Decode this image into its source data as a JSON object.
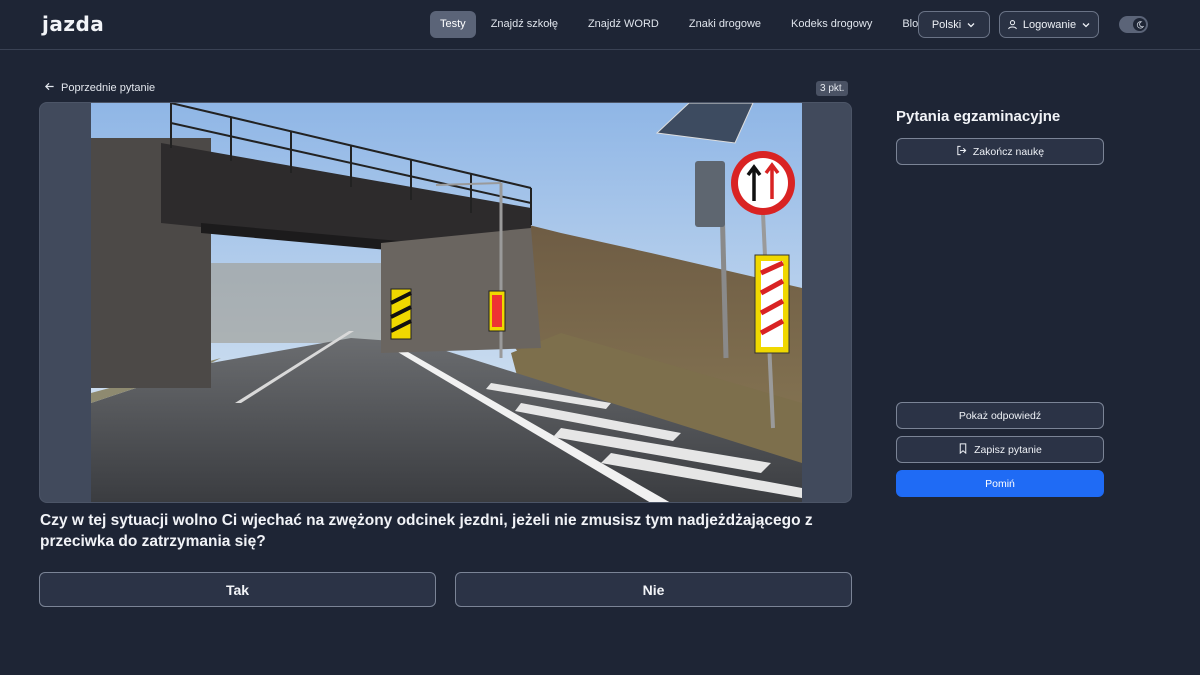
{
  "header": {
    "logo": "jazda",
    "nav": [
      {
        "label": "Testy",
        "active": true
      },
      {
        "label": "Znajdź szkołę",
        "active": false
      },
      {
        "label": "Znajdź WORD",
        "active": false
      },
      {
        "label": "Znaki drogowe",
        "active": false
      },
      {
        "label": "Kodeks drogowy",
        "active": false
      },
      {
        "label": "Blog",
        "active": false
      }
    ],
    "language": "Polski",
    "login": "Logowanie",
    "theme_icon": "moon-icon"
  },
  "main": {
    "back_label": "Poprzednie pytanie",
    "points": "3 pkt.",
    "question": "Czy w tej sytuacji wolno Ci wjechać na zwężony odcinek jezdni, jeżeli nie zmusisz tym nadjeżdżającego z przeciwka do zatrzymania się?",
    "answers": [
      "Tak",
      "Nie"
    ]
  },
  "sidebar": {
    "title": "Pytania egzaminacyjne",
    "finish_label": "Zakończ naukę",
    "show_answer_label": "Pokaż odpowiedź",
    "save_label": "Zapisz pytanie",
    "skip_label": "Pomiń"
  },
  "colors": {
    "background": "#1e2535",
    "accent": "#1f6bf5",
    "active_nav": "#5b6478"
  }
}
